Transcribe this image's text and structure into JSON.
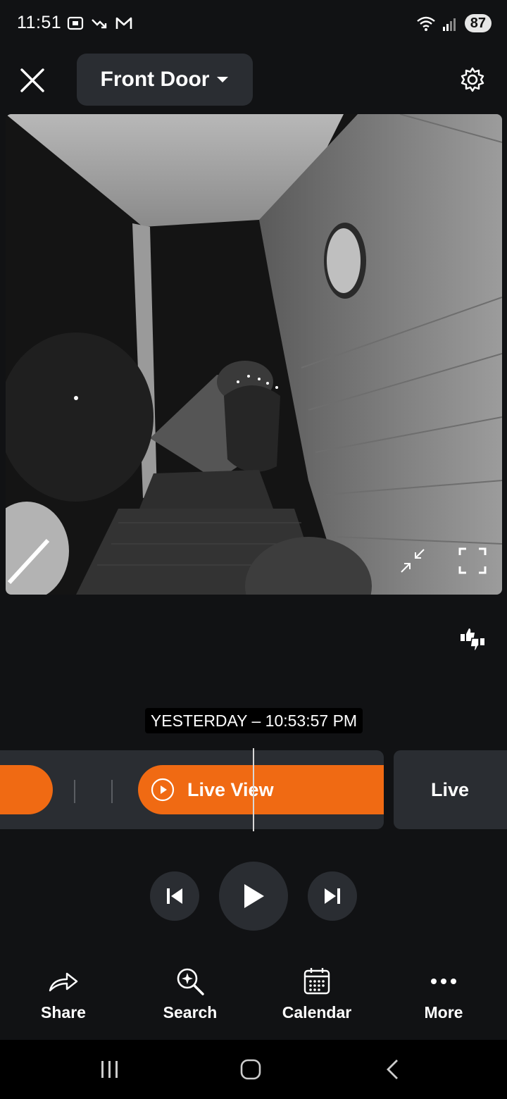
{
  "status_bar": {
    "time": "11:51",
    "battery": "87",
    "icons": [
      "screenshot-icon",
      "trending-down-icon",
      "gmail-icon",
      "wifi-icon",
      "signal-icon",
      "battery-icon"
    ]
  },
  "header": {
    "camera_name": "Front Door",
    "icons": [
      "close-icon",
      "chevron-down-icon",
      "gear-icon"
    ]
  },
  "video": {
    "description_icons": [
      "exit-fullscreen-icon",
      "fullscreen-icon"
    ]
  },
  "timeline": {
    "timestamp": "YESTERDAY – 10:53:57 PM",
    "live_view_label": "Live View",
    "live_label": "Live"
  },
  "playback": {
    "icons": [
      "skip-previous-icon",
      "play-icon",
      "skip-next-icon"
    ]
  },
  "actions": [
    {
      "label": "Share",
      "icon": "share-icon"
    },
    {
      "label": "Search",
      "icon": "search-icon"
    },
    {
      "label": "Calendar",
      "icon": "calendar-icon"
    },
    {
      "label": "More",
      "icon": "more-icon"
    }
  ],
  "colors": {
    "accent": "#f06a13",
    "background": "#111214",
    "surface": "#2a2d32"
  }
}
